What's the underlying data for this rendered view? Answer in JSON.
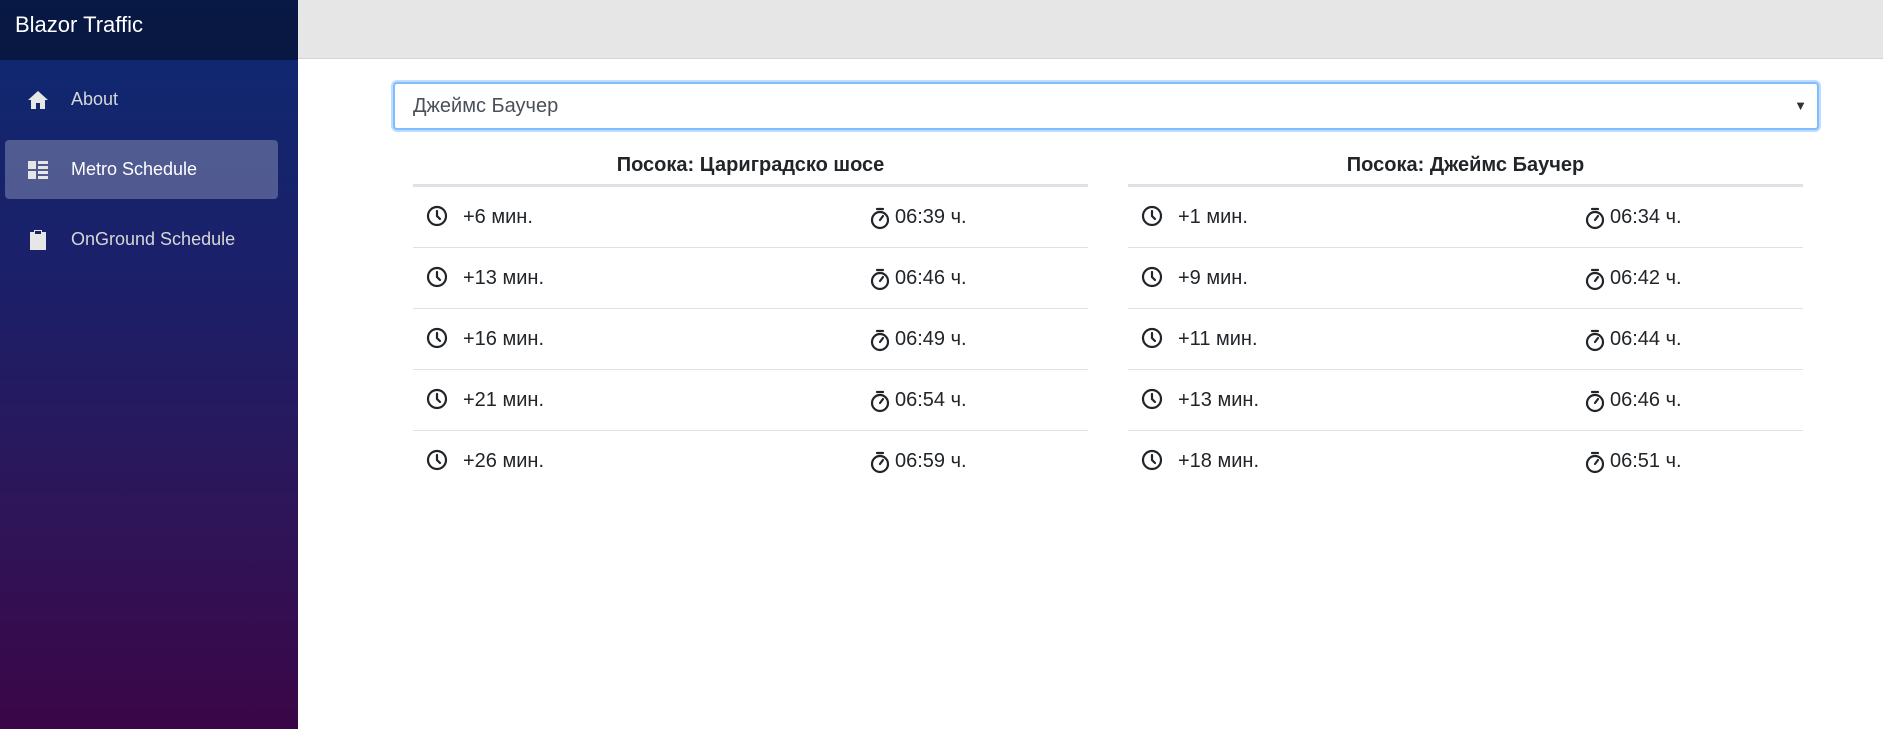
{
  "app": {
    "brand": "Blazor Traffic"
  },
  "sidebar": {
    "items": [
      {
        "label": "About",
        "icon": "home-icon",
        "active": false
      },
      {
        "label": "Metro Schedule",
        "icon": "dashboard-list-icon",
        "active": true
      },
      {
        "label": "OnGround Schedule",
        "icon": "clipboard-icon",
        "active": false
      }
    ]
  },
  "station_select": {
    "selected": "Джеймс Баучер"
  },
  "directions": [
    {
      "title": "Посока: Цариградско шосе",
      "rows": [
        {
          "wait": "+6 мин.",
          "time": "06:39 ч."
        },
        {
          "wait": "+13 мин.",
          "time": "06:46 ч."
        },
        {
          "wait": "+16 мин.",
          "time": "06:49 ч."
        },
        {
          "wait": "+21 мин.",
          "time": "06:54 ч."
        },
        {
          "wait": "+26 мин.",
          "time": "06:59 ч."
        }
      ]
    },
    {
      "title": "Посока: Джеймс Баучер",
      "rows": [
        {
          "wait": "+1 мин.",
          "time": "06:34 ч."
        },
        {
          "wait": "+9 мин.",
          "time": "06:42 ч."
        },
        {
          "wait": "+11 мин.",
          "time": "06:44 ч."
        },
        {
          "wait": "+13 мин.",
          "time": "06:46 ч."
        },
        {
          "wait": "+18 мин.",
          "time": "06:51 ч."
        }
      ]
    }
  ],
  "colors": {
    "sidebar_top": "#0d2a72",
    "sidebar_bottom": "#3a0647",
    "topbar": "#e6e6e6",
    "focus_border": "#80bdff"
  }
}
